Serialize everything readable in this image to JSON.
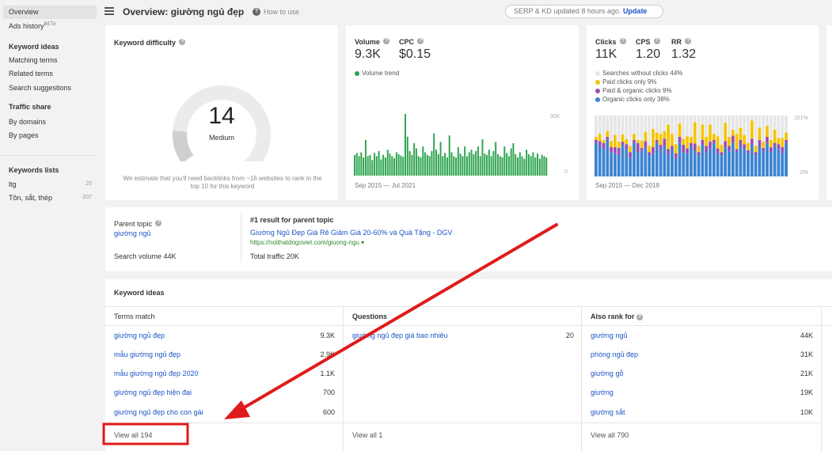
{
  "sidebar": {
    "overview": "Overview",
    "ads_history": "Ads history",
    "ads_beta": "BETA",
    "keyword_ideas_head": "Keyword ideas",
    "matching_terms": "Matching terms",
    "related_terms": "Related terms",
    "search_suggestions": "Search suggestions",
    "traffic_share_head": "Traffic share",
    "by_domains": "By domains",
    "by_pages": "By pages",
    "keywords_lists_head": "Keywords lists",
    "lists": [
      {
        "name": "ltg",
        "count": "25"
      },
      {
        "name": "Tôn, sắt, thép",
        "count": "207"
      }
    ]
  },
  "header": {
    "title": "Overview: giường ngủ đẹp",
    "how_to_use": "How to use",
    "serp_status": "SERP & KD updated 8 hours ago.",
    "update_label": "Update"
  },
  "kd": {
    "label": "Keyword difficulty",
    "value": "14",
    "rating": "Medium",
    "gauge_fraction": 0.14,
    "note": "We estimate that you'll need backlinks from ~16 websites to rank in the top 10 for this keyword"
  },
  "volume": {
    "volume_label": "Volume",
    "cpc_label": "CPC",
    "volume_value": "9.3K",
    "cpc_value": "$0.15",
    "trend_label": "Volume trend",
    "y_max": "30K",
    "y_min": "0",
    "range": "Sep 2015 — Jul 2021",
    "bars": [
      0.32,
      0.35,
      0.3,
      0.36,
      0.28,
      0.55,
      0.3,
      0.32,
      0.24,
      0.35,
      0.3,
      0.38,
      0.25,
      0.32,
      0.28,
      0.4,
      0.34,
      0.3,
      0.27,
      0.36,
      0.33,
      0.31,
      0.29,
      0.95,
      0.6,
      0.38,
      0.32,
      0.5,
      0.42,
      0.3,
      0.28,
      0.45,
      0.36,
      0.32,
      0.3,
      0.38,
      0.65,
      0.4,
      0.33,
      0.52,
      0.3,
      0.35,
      0.28,
      0.62,
      0.36,
      0.3,
      0.28,
      0.44,
      0.34,
      0.3,
      0.45,
      0.3,
      0.36,
      0.4,
      0.33,
      0.38,
      0.45,
      0.3,
      0.56,
      0.34,
      0.32,
      0.4,
      0.3,
      0.38,
      0.52,
      0.33,
      0.3,
      0.28,
      0.45,
      0.35,
      0.3,
      0.42,
      0.5,
      0.33,
      0.28,
      0.36,
      0.3,
      0.26,
      0.4,
      0.33,
      0.3,
      0.36,
      0.28,
      0.34,
      0.26,
      0.32,
      0.3,
      0.28
    ]
  },
  "clicks": {
    "clicks_label": "Clicks",
    "cps_label": "CPS",
    "rr_label": "RR",
    "clicks_value": "11K",
    "cps_value": "1.20",
    "rr_value": "1.32",
    "legend": [
      {
        "label": "Searches without clicks 44%",
        "color": "#e6e6e6"
      },
      {
        "label": "Paid clicks only 9%",
        "color": "#f5c400"
      },
      {
        "label": "Paid & organic clicks 9%",
        "color": "#9b4fb0"
      },
      {
        "label": "Organic clicks only 38%",
        "color": "#3b83d1"
      }
    ],
    "y_max": "101%",
    "y_min": "0%",
    "range": "Sep 2015 — Dec 2019",
    "bars": [
      [
        0.55,
        0.05,
        0.05
      ],
      [
        0.5,
        0.12,
        0.08
      ],
      [
        0.45,
        0.05,
        0.1
      ],
      [
        0.6,
        0.1,
        0.05
      ],
      [
        0.4,
        0.1,
        0.08
      ],
      [
        0.38,
        0.2,
        0.1
      ],
      [
        0.35,
        0.1,
        0.12
      ],
      [
        0.52,
        0.12,
        0.05
      ],
      [
        0.45,
        0.08,
        0.08
      ],
      [
        0.3,
        0.1,
        0.1
      ],
      [
        0.55,
        0.1,
        0.05
      ],
      [
        0.4,
        0.05,
        0.15
      ],
      [
        0.42,
        0.12,
        0.05
      ],
      [
        0.48,
        0.15,
        0.1
      ],
      [
        0.35,
        0.1,
        0.05
      ],
      [
        0.38,
        0.3,
        0.1
      ],
      [
        0.55,
        0.12,
        0.05
      ],
      [
        0.42,
        0.18,
        0.1
      ],
      [
        0.5,
        0.12,
        0.12
      ],
      [
        0.35,
        0.4,
        0.1
      ],
      [
        0.45,
        0.2,
        0.05
      ],
      [
        0.3,
        0.15,
        0.08
      ],
      [
        0.55,
        0.22,
        0.1
      ],
      [
        0.4,
        0.1,
        0.12
      ],
      [
        0.38,
        0.2,
        0.08
      ],
      [
        0.5,
        0.1,
        0.05
      ],
      [
        0.42,
        0.35,
        0.12
      ],
      [
        0.35,
        0.1,
        0.05
      ],
      [
        0.52,
        0.25,
        0.08
      ],
      [
        0.4,
        0.15,
        0.1
      ],
      [
        0.45,
        0.28,
        0.12
      ],
      [
        0.55,
        0.1,
        0.05
      ],
      [
        0.38,
        0.2,
        0.08
      ],
      [
        0.35,
        0.12,
        0.05
      ],
      [
        0.48,
        0.3,
        0.1
      ],
      [
        0.42,
        0.15,
        0.08
      ],
      [
        0.55,
        0.1,
        0.12
      ],
      [
        0.4,
        0.25,
        0.05
      ],
      [
        0.5,
        0.2,
        0.1
      ],
      [
        0.45,
        0.15,
        0.08
      ],
      [
        0.38,
        0.12,
        0.05
      ],
      [
        0.52,
        0.3,
        0.1
      ],
      [
        0.35,
        0.1,
        0.05
      ],
      [
        0.48,
        0.2,
        0.12
      ],
      [
        0.42,
        0.1,
        0.05
      ],
      [
        0.55,
        0.18,
        0.1
      ],
      [
        0.4,
        0.12,
        0.08
      ],
      [
        0.5,
        0.22,
        0.05
      ],
      [
        0.45,
        0.1,
        0.08
      ],
      [
        0.38,
        0.15,
        0.1
      ],
      [
        0.55,
        0.12,
        0.05
      ]
    ]
  },
  "parent": {
    "label": "Parent topic",
    "keyword": "giường ngủ",
    "search_volume": "Search volume 44K",
    "first_result_label": "#1 result for parent topic",
    "result_title": "Giường Ngủ Đẹp Giá Rẻ Giảm Giá 20-60% và Quà Tặng - DGV",
    "result_url": "https://noithatdogoviet.com/giuong-ngu ▾",
    "total_traffic": "Total traffic 20K"
  },
  "ideas": {
    "title": "Keyword ideas",
    "columns": [
      {
        "label": "Terms match",
        "rows": [
          {
            "kw": "giường ngủ đẹp",
            "val": "9.3K"
          },
          {
            "kw": "mẫu giường ngủ đẹp",
            "val": "2.9K"
          },
          {
            "kw": "mẫu giường ngủ đẹp 2020",
            "val": "1.1K"
          },
          {
            "kw": "giường ngủ đẹp hiện đại",
            "val": "700"
          },
          {
            "kw": "giường ngủ đẹp cho con gái",
            "val": "600"
          }
        ],
        "view_all": "View all 194"
      },
      {
        "label": "Questions",
        "rows": [
          {
            "kw": "giường ngủ đẹp giá bao nhiêu",
            "val": "20"
          }
        ],
        "view_all": "View all 1"
      },
      {
        "label": "Also rank for",
        "rows": [
          {
            "kw": "giường ngủ",
            "val": "44K"
          },
          {
            "kw": "phòng ngủ đẹp",
            "val": "31K"
          },
          {
            "kw": "giường gỗ",
            "val": "21K"
          },
          {
            "kw": "giường",
            "val": "19K"
          },
          {
            "kw": "giường sắt",
            "val": "10K"
          }
        ],
        "view_all": "View all 790"
      }
    ]
  },
  "colors": {
    "link": "#1a55c4",
    "volume_bar": "#2ea44f",
    "annotation": "#e01b1b"
  }
}
